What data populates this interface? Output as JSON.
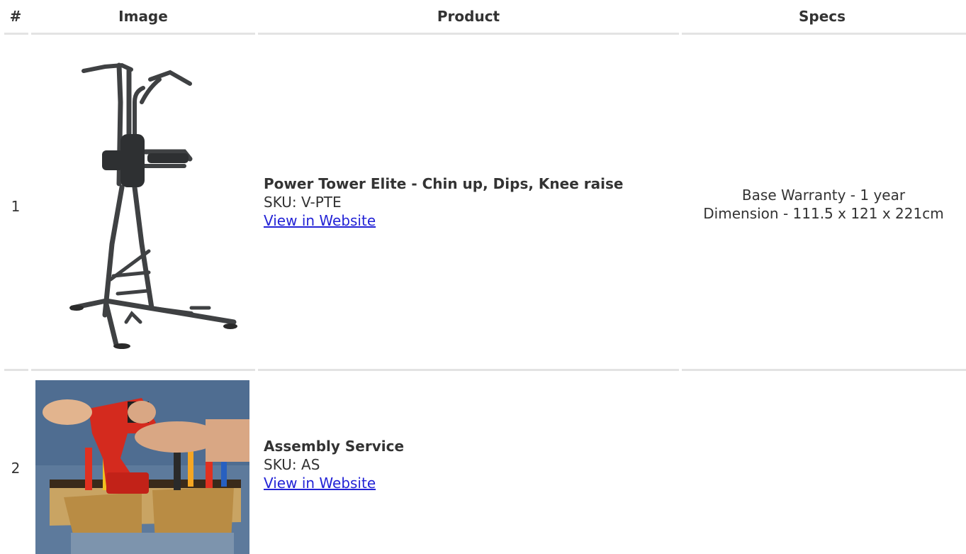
{
  "headers": {
    "num": "#",
    "image": "Image",
    "product": "Product",
    "specs": "Specs"
  },
  "rows": [
    {
      "num": "1",
      "image_icon": "power-tower-image",
      "product_name": "Power Tower Elite - Chin up, Dips, Knee raise",
      "sku": "SKU: V-PTE",
      "link": "View in Website",
      "specs": [
        "Base Warranty - 1 year",
        "Dimension - 111.5 x 121 x 221cm"
      ]
    },
    {
      "num": "2",
      "image_icon": "assembly-worker-image",
      "product_name": "Assembly Service",
      "sku": "SKU: AS",
      "link": "View in Website",
      "specs": []
    }
  ],
  "colors": {
    "link": "#2323d6",
    "text": "#333333",
    "rule": "#e3e3e3"
  }
}
